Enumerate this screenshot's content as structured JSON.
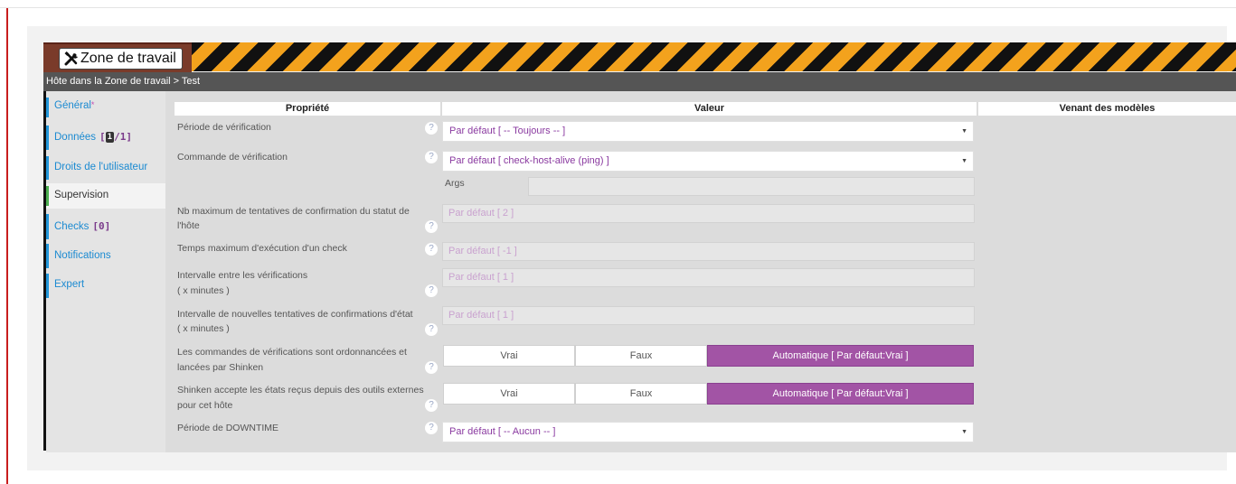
{
  "workspace": {
    "title": "Zone de travail",
    "icon": "tools-icon"
  },
  "breadcrumb": "Hôte dans la Zone de travail > Test",
  "sidebar": {
    "general": {
      "label": "Général",
      "required": "*"
    },
    "donnees": {
      "label": "Données",
      "count_icon": "1",
      "count": "/1]",
      "open_bracket": "["
    },
    "droits": {
      "label": "Droits de l'utilisateur"
    },
    "supervision": {
      "label": "Supervision"
    },
    "checks": {
      "label": "Checks",
      "count": "[0]"
    },
    "notifications": {
      "label": "Notifications"
    },
    "expert": {
      "label": "Expert"
    }
  },
  "table": {
    "headers": {
      "property": "Propriété",
      "value": "Valeur",
      "templates": "Venant des modèles"
    }
  },
  "help_glyph": "?",
  "rows": {
    "periode": {
      "label": "Période de vérification",
      "value": "Par défaut [ -- Toujours -- ]"
    },
    "commande": {
      "label": "Commande de vérification",
      "value": "Par défaut [ check-host-alive (ping) ]",
      "args_label": "Args"
    },
    "tentatives": {
      "label1": "Nb maximum de tentatives de confirmation du statut de",
      "label2": "l'hôte",
      "placeholder": "Par défaut [ 2 ]"
    },
    "temps": {
      "label": "Temps maximum d'exécution d'un check",
      "placeholder": "Par défaut [ -1 ]"
    },
    "intervalle": {
      "label1": "Intervalle entre les vérifications",
      "label2": "( x minutes )",
      "placeholder": "Par défaut [ 1 ]"
    },
    "retry": {
      "label1": "Intervalle de nouvelles tentatives de confirmations d'état",
      "label2": "( x minutes )",
      "placeholder": "Par défaut [ 1 ]"
    },
    "ordonnancees": {
      "label1": "Les commandes de vérifications sont ordonnancées et",
      "label2": "lancées par Shinken",
      "vrai": "Vrai",
      "faux": "Faux",
      "auto": "Automatique [ Par défaut:Vrai ]"
    },
    "externes": {
      "label1": "Shinken accepte les états reçus depuis des outils externes",
      "label2": "pour cet hôte",
      "vrai": "Vrai",
      "faux": "Faux",
      "auto": "Automatique [ Par défaut:Vrai ]"
    },
    "downtime": {
      "label": "Période de DOWNTIME",
      "value": "Par défaut [ -- Aucun -- ]"
    }
  },
  "colors": {
    "accent": "#a254a5",
    "link": "#1b8ad1",
    "breadcrumb_bg": "#555555",
    "hazard_orange": "#f3a21d"
  }
}
